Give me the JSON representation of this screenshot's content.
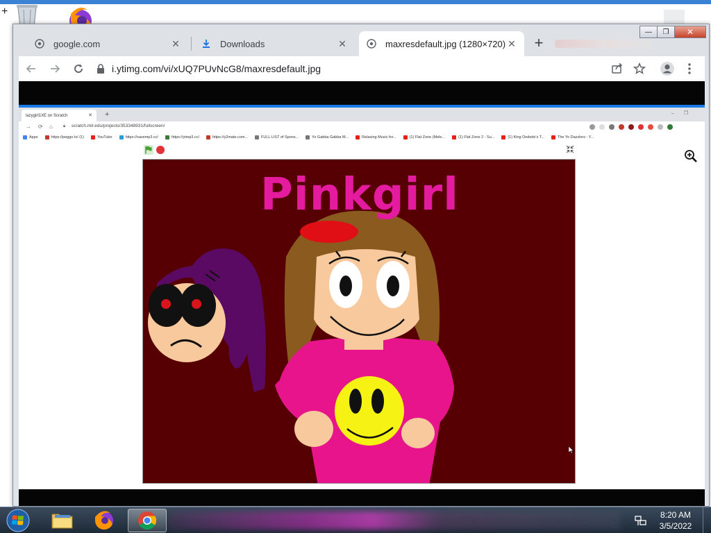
{
  "browser": {
    "tabs": [
      {
        "title": "google.com",
        "icon": "globe-icon"
      },
      {
        "title": "Downloads",
        "icon": "download-icon"
      },
      {
        "title": "maxresdefault.jpg (1280×720)",
        "icon": "globe-icon",
        "active": true
      }
    ],
    "address": "i.ytimg.com/vi/xUQ7PUvNcG8/maxresdefault.jpg"
  },
  "inner": {
    "tab_title": "lazygirl1XE on Scratch",
    "url": "scratch.mit.edu/projects/353348931/fullscreen/",
    "bookmarks": [
      {
        "label": "Apps",
        "color": "#4285f4"
      },
      {
        "label": "https://peggo.tv/ (1)",
        "color": "#c0392b"
      },
      {
        "label": "YouTube",
        "color": "#e62117"
      },
      {
        "label": "https://savemp3.cc/",
        "color": "#2a9fd6"
      },
      {
        "label": "https://ytmp3.cc/",
        "color": "#3a7a3a"
      },
      {
        "label": "https://y2mate.com...",
        "color": "#c0392b"
      },
      {
        "label": "FULL LIST of Spons...",
        "color": "#777777"
      },
      {
        "label": "Yo Gabba Gabba M...",
        "color": "#777777"
      },
      {
        "label": "Relaxing Music for...",
        "color": "#e62117"
      },
      {
        "label": "(1) Flat Zone (Mele...",
        "color": "#e62117"
      },
      {
        "label": "(1) Flat Zone 2 - Su...",
        "color": "#e62117"
      },
      {
        "label": "(1) King Dedede's T...",
        "color": "#e62117"
      },
      {
        "label": "The Yo Dazzlers - Y...",
        "color": "#e62117"
      }
    ],
    "stage_title": "Pinkgirl"
  },
  "taskbar": {
    "time": "8:20 AM",
    "date": "3/5/2022"
  },
  "colors": {
    "stage_bg": "#560004",
    "title_pink": "#e41a9f",
    "shirt_pink": "#e8148c",
    "skin": "#f7c99c",
    "hair_brown": "#8a5a1e",
    "hair_purple": "#5b0a63",
    "smiley_yellow": "#f6f214"
  }
}
